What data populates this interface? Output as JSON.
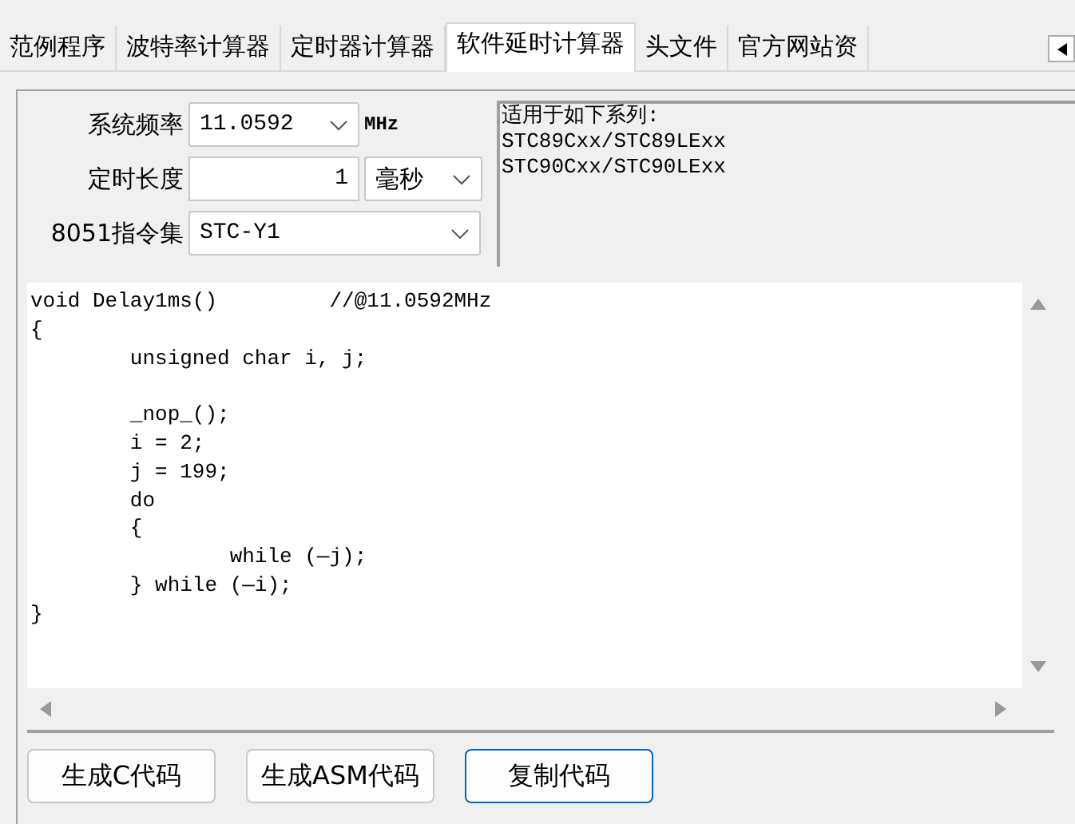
{
  "tabs": [
    {
      "label": "范例程序",
      "selected": false
    },
    {
      "label": "波特率计算器",
      "selected": false
    },
    {
      "label": "定时器计算器",
      "selected": false
    },
    {
      "label": "软件延时计算器",
      "selected": true
    },
    {
      "label": "头文件",
      "selected": false
    },
    {
      "label": "官方网站资",
      "selected": false
    }
  ],
  "settings": {
    "frequency": {
      "label": "系统频率",
      "value": "11.0592",
      "unit": "MHz"
    },
    "duration": {
      "label": "定时长度",
      "value": "1",
      "unit": "毫秒"
    },
    "instruction_set": {
      "label": "8051指令集",
      "value": "STC-Y1"
    }
  },
  "info": {
    "title": "适用于如下系列:",
    "lines": [
      "STC89Cxx/STC89LExx",
      "STC90Cxx/STC90LExx"
    ]
  },
  "code": "void Delay1ms()\t\t//@11.0592MHz\n{\n\tunsigned char i, j;\n\n\t_nop_();\n\ti = 2;\n\tj = 199;\n\tdo\n\t{\n\t\twhile (—j);\n\t} while (—i);\n}",
  "buttons": [
    {
      "label": "生成C代码",
      "selected": false
    },
    {
      "label": "生成ASM代码",
      "selected": false
    },
    {
      "label": "复制代码",
      "selected": true
    }
  ]
}
